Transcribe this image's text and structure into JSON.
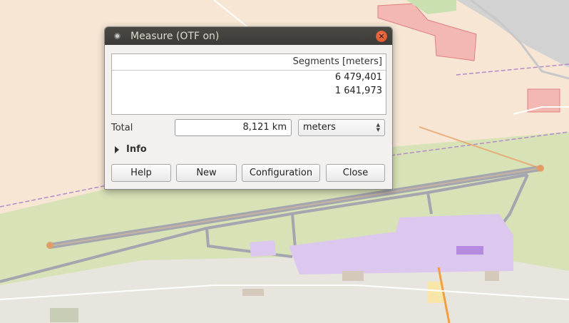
{
  "dialog": {
    "title": "Measure (OTF on)",
    "close_glyph": "×",
    "table": {
      "header": "Segments [meters]",
      "rows": [
        "6 479,401",
        "1 641,973"
      ]
    },
    "total_label": "Total",
    "total_value": "8,121 km",
    "unit_selected": "meters",
    "info_label": "Info",
    "buttons": {
      "help": "Help",
      "new": "New",
      "configuration": "Configuration",
      "close": "Close"
    }
  },
  "colors": {
    "titlebar": "#3c3b37",
    "close_button": "#e05a2b",
    "measure_line": "#e8a26a",
    "runway": "#9a9ea8",
    "grass": "#d9e3ba",
    "terminal": "#dcc8ee"
  },
  "icons": [
    "app-icon",
    "close-icon",
    "expand-triangle-icon",
    "spin-arrows-icon"
  ]
}
